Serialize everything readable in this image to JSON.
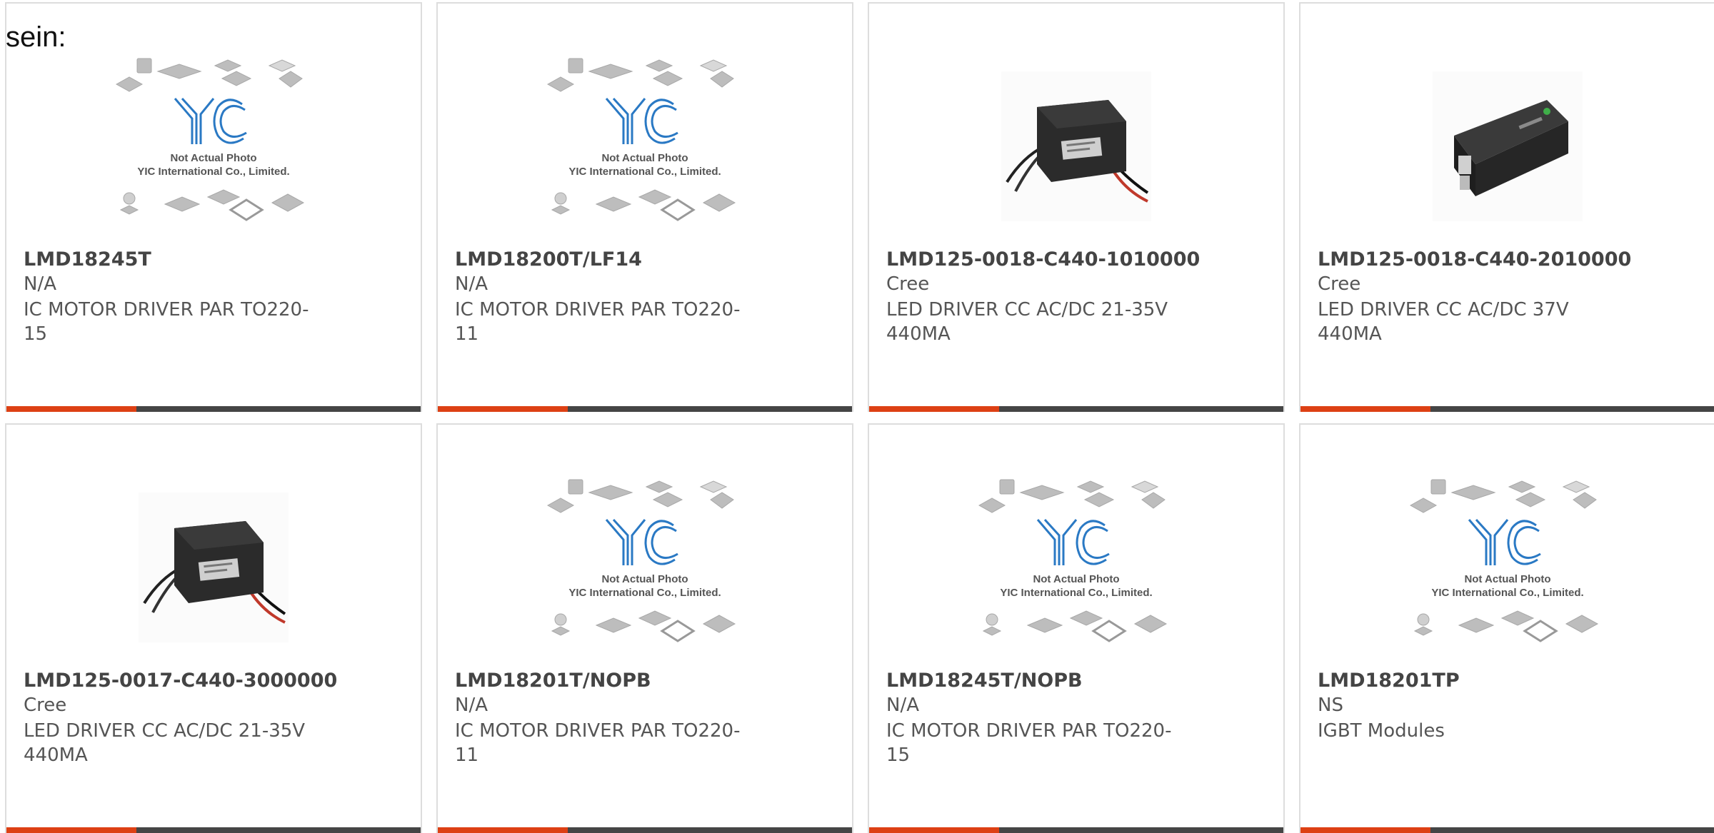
{
  "page": {
    "lead_text": "sein:"
  },
  "colors": {
    "accent": "#dd4014",
    "bar": "#454545",
    "border": "#dddddd",
    "text": "#555555",
    "title": "#444444"
  },
  "placeholder": {
    "line1": "Not Actual Photo",
    "line2": "YIC International Co., Limited."
  },
  "products": [
    {
      "part_number": "LMD18245T",
      "manufacturer": "N/A",
      "description_line1": "IC MOTOR DRIVER PAR TO220-",
      "description_line2": "15",
      "image": "placeholder"
    },
    {
      "part_number": "LMD18200T/LF14",
      "manufacturer": "N/A",
      "description_line1": "IC MOTOR DRIVER PAR TO220-",
      "description_line2": "11",
      "image": "placeholder"
    },
    {
      "part_number": "LMD125-0018-C440-1010000",
      "manufacturer": "Cree",
      "description_line1": "LED DRIVER CC AC/DC 21-35V",
      "description_line2": "440MA",
      "image": "led-driver-wired"
    },
    {
      "part_number": "LMD125-0018-C440-2010000",
      "manufacturer": "Cree",
      "description_line1": "LED DRIVER CC AC/DC 37V",
      "description_line2": "440MA",
      "image": "led-driver-terminal"
    },
    {
      "part_number": "LMD125-0017-C440-3000000",
      "manufacturer": "Cree",
      "description_line1": "LED DRIVER CC AC/DC 21-35V",
      "description_line2": "440MA",
      "image": "led-driver-wired"
    },
    {
      "part_number": "LMD18201T/NOPB",
      "manufacturer": "N/A",
      "description_line1": "IC MOTOR DRIVER PAR TO220-",
      "description_line2": "11",
      "image": "placeholder"
    },
    {
      "part_number": "LMD18245T/NOPB",
      "manufacturer": "N/A",
      "description_line1": "IC MOTOR DRIVER PAR TO220-",
      "description_line2": "15",
      "image": "placeholder"
    },
    {
      "part_number": "LMD18201TP",
      "manufacturer": "NS",
      "description_line1": "IGBT Modules",
      "description_line2": "",
      "image": "placeholder"
    }
  ]
}
